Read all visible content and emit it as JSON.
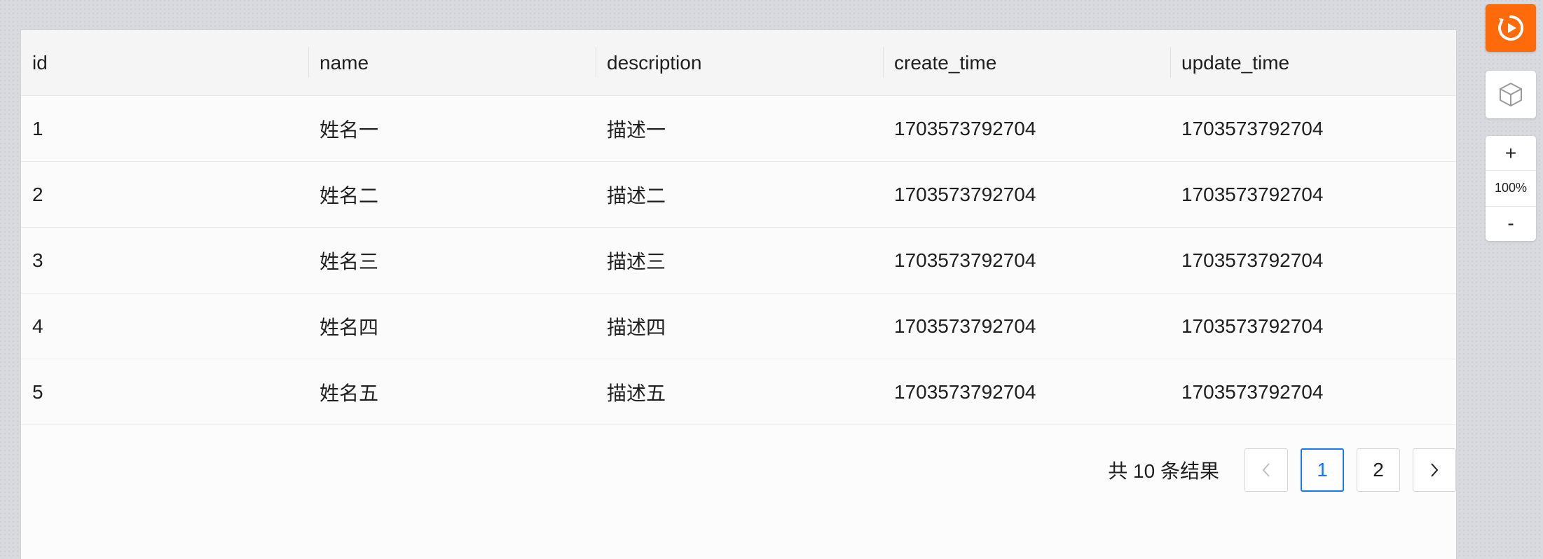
{
  "table": {
    "columns": [
      "id",
      "name",
      "description",
      "create_time",
      "update_time"
    ],
    "rows": [
      [
        "1",
        "姓名一",
        "描述一",
        "1703573792704",
        "1703573792704"
      ],
      [
        "2",
        "姓名二",
        "描述二",
        "1703573792704",
        "1703573792704"
      ],
      [
        "3",
        "姓名三",
        "描述三",
        "1703573792704",
        "1703573792704"
      ],
      [
        "4",
        "姓名四",
        "描述四",
        "1703573792704",
        "1703573792704"
      ],
      [
        "5",
        "姓名五",
        "描述五",
        "1703573792704",
        "1703573792704"
      ]
    ]
  },
  "pagination": {
    "total_text": "共 10 条结果",
    "prev_icon": "chevron-left-icon",
    "next_icon": "chevron-right-icon",
    "pages": [
      "1",
      "2"
    ],
    "current_page": "1"
  },
  "tools": {
    "primary_icon": "play-circle-icon",
    "secondary_icon": "cube-icon",
    "zoom_in": "+",
    "zoom_level": "100%",
    "zoom_out": "-"
  },
  "colors": {
    "accent": "#1677ff",
    "tool_orange": "#ff6a0a"
  }
}
